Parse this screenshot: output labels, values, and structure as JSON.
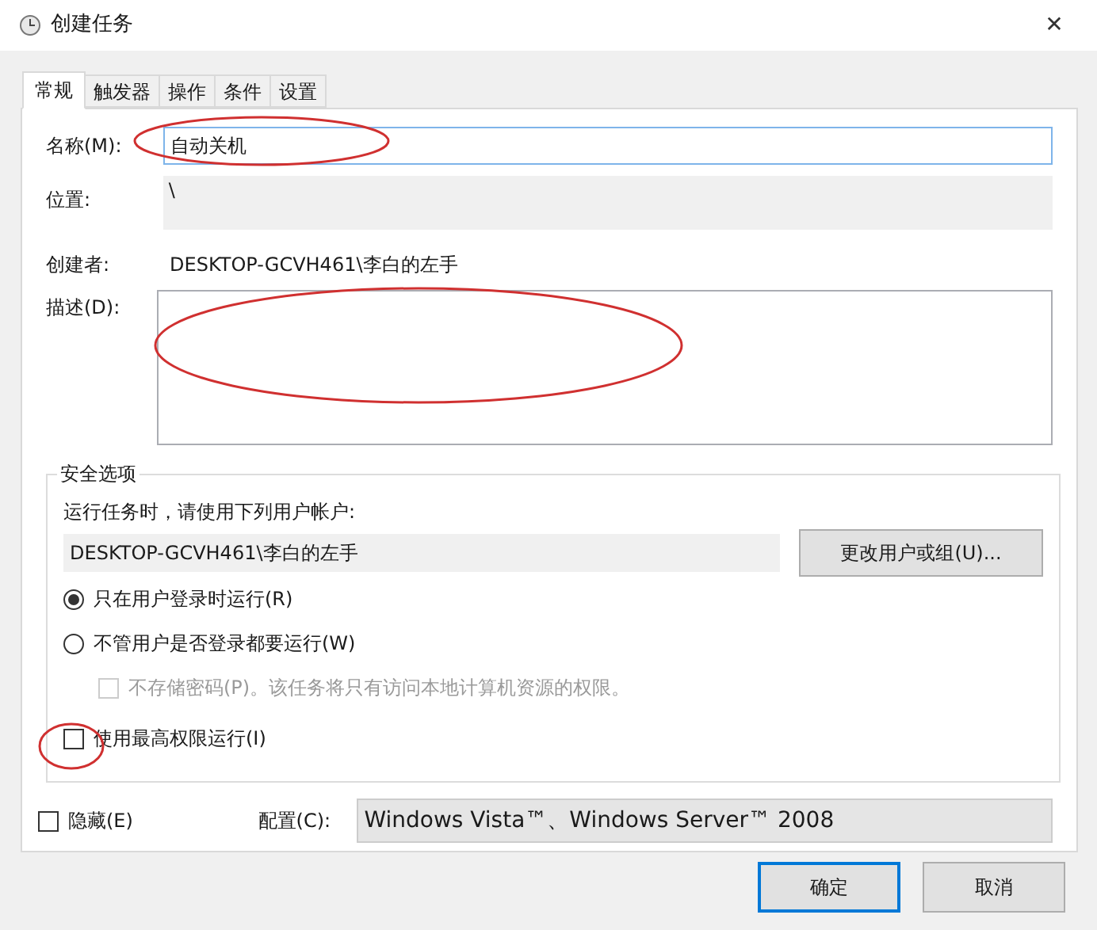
{
  "window": {
    "title": "创建任务",
    "close": "✕"
  },
  "tabs": [
    {
      "label": "常规",
      "selected": true
    },
    {
      "label": "触发器",
      "selected": false
    },
    {
      "label": "操作",
      "selected": false
    },
    {
      "label": "条件",
      "selected": false
    },
    {
      "label": "设置",
      "selected": false
    }
  ],
  "name": {
    "label": "名称(M):",
    "value": "自动关机"
  },
  "location": {
    "label": "位置:",
    "value": "\\"
  },
  "author": {
    "label": "创建者:",
    "value": "DESKTOP-GCVH461\\李白的左手"
  },
  "description": {
    "label": "描述(D):"
  },
  "security": {
    "title": "安全选项",
    "prompt": "运行任务时，请使用下列用户帐户:",
    "account": "DESKTOP-GCVH461\\李白的左手",
    "change_button": "更改用户或组(U)...",
    "options": [
      {
        "kind": "radio",
        "label": "只在用户登录时运行(R)",
        "selected": true
      },
      {
        "kind": "radio",
        "label": "不管用户是否登录都要运行(W)",
        "selected": false
      },
      {
        "kind": "checkbox",
        "label": "不存储密码(P)。该任务将只有访问本地计算机资源的权限。",
        "checked": false,
        "disabled": true
      },
      {
        "kind": "checkbox",
        "label": "使用最高权限运行(I)",
        "checked": false,
        "disabled": false
      }
    ]
  },
  "hidden": {
    "label": "隐藏(E)",
    "checked": false
  },
  "config": {
    "label": "配置(C):",
    "value": "Windows Vista™、Windows Server™ 2008"
  },
  "buttons": [
    {
      "label": "确定",
      "default": true
    },
    {
      "label": "取消",
      "default": false
    }
  ]
}
